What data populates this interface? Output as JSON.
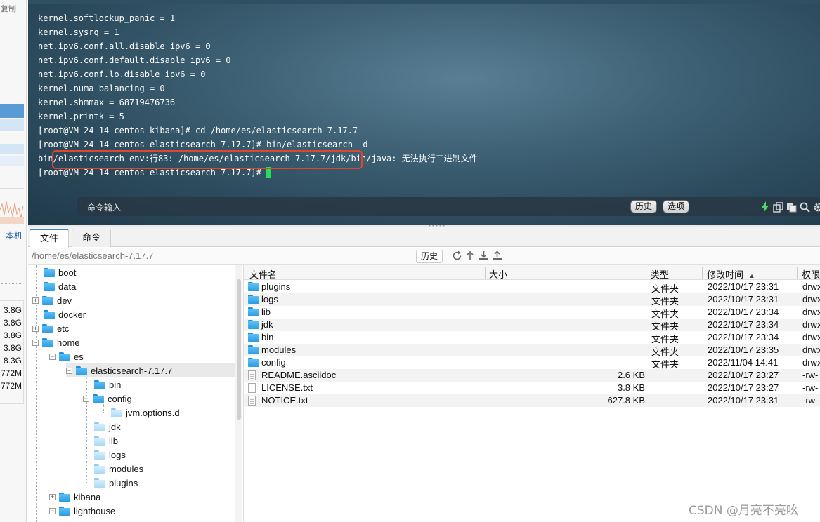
{
  "left_strip": {
    "copy_label": "复制",
    "local_label": "本机",
    "memory_values": [
      "3.8G",
      "3.8G",
      "3.8G",
      "3.8G",
      "8.3G",
      "772M",
      "772M"
    ]
  },
  "terminal": {
    "lines": [
      "kernel.softlockup_panic = 1",
      "kernel.sysrq = 1",
      "net.ipv6.conf.all.disable_ipv6 = 0",
      "net.ipv6.conf.default.disable_ipv6 = 0",
      "net.ipv6.conf.lo.disable_ipv6 = 0",
      "kernel.numa_balancing = 0",
      "kernel.shmmax = 68719476736",
      "kernel.printk = 5",
      "[root@VM-24-14-centos kibana]# cd /home/es/elasticsearch-7.17.7",
      "[root@VM-24-14-centos elasticsearch-7.17.7]# bin/elasticsearch -d",
      "bin/elasticsearch-env:行83: /home/es/elasticsearch-7.17.7/jdk/bin/java: 无法执行二进制文件"
    ],
    "prompt": "[root@VM-24-14-centos elasticsearch-7.17.7]# ",
    "command_placeholder": "命令输入",
    "history_button": "历史",
    "options_button": "选项",
    "highlight_color": "#e2452d",
    "cursor_color": "#22e05a"
  },
  "tabs": {
    "files": "文件",
    "commands": "命令"
  },
  "pathbar": {
    "path": "/home/es/elasticsearch-7.17.7",
    "history_button": "历史"
  },
  "tree": {
    "nodes": [
      {
        "label": "boot"
      },
      {
        "label": "data"
      },
      {
        "label": "dev"
      },
      {
        "label": "docker"
      },
      {
        "label": "etc"
      },
      {
        "label": "home"
      },
      {
        "label": "es"
      },
      {
        "label": "elasticsearch-7.17.7"
      },
      {
        "label": "bin"
      },
      {
        "label": "config"
      },
      {
        "label": "jvm.options.d"
      },
      {
        "label": "jdk"
      },
      {
        "label": "lib"
      },
      {
        "label": "logs"
      },
      {
        "label": "modules"
      },
      {
        "label": "plugins"
      },
      {
        "label": "kibana"
      },
      {
        "label": "lighthouse"
      }
    ]
  },
  "filelist": {
    "columns": {
      "name": "文件名",
      "size": "大小",
      "type": "类型",
      "modified": "修改时间",
      "perms": "权限"
    },
    "rows": [
      {
        "name": "plugins",
        "size": "",
        "type": "文件夹",
        "modified": "2022/10/17 23:31",
        "perms": "drwx"
      },
      {
        "name": "logs",
        "size": "",
        "type": "文件夹",
        "modified": "2022/10/17 23:31",
        "perms": "drwx"
      },
      {
        "name": "lib",
        "size": "",
        "type": "文件夹",
        "modified": "2022/10/17 23:34",
        "perms": "drwx"
      },
      {
        "name": "jdk",
        "size": "",
        "type": "文件夹",
        "modified": "2022/10/17 23:34",
        "perms": "drwx"
      },
      {
        "name": "bin",
        "size": "",
        "type": "文件夹",
        "modified": "2022/10/17 23:34",
        "perms": "drwx"
      },
      {
        "name": "modules",
        "size": "",
        "type": "文件夹",
        "modified": "2022/10/17 23:35",
        "perms": "drwx"
      },
      {
        "name": "config",
        "size": "",
        "type": "文件夹",
        "modified": "2022/11/04 14:41",
        "perms": "drwx"
      },
      {
        "name": "README.asciidoc",
        "size": "2.6 KB",
        "type": "",
        "modified": "2022/10/17 23:27",
        "perms": "-rw-"
      },
      {
        "name": "LICENSE.txt",
        "size": "3.8 KB",
        "type": "",
        "modified": "2022/10/17 23:27",
        "perms": "-rw-"
      },
      {
        "name": "NOTICE.txt",
        "size": "627.8 KB",
        "type": "",
        "modified": "2022/10/17 23:31",
        "perms": "-rw-"
      }
    ]
  },
  "watermark": "CSDN @月亮不亮吆"
}
